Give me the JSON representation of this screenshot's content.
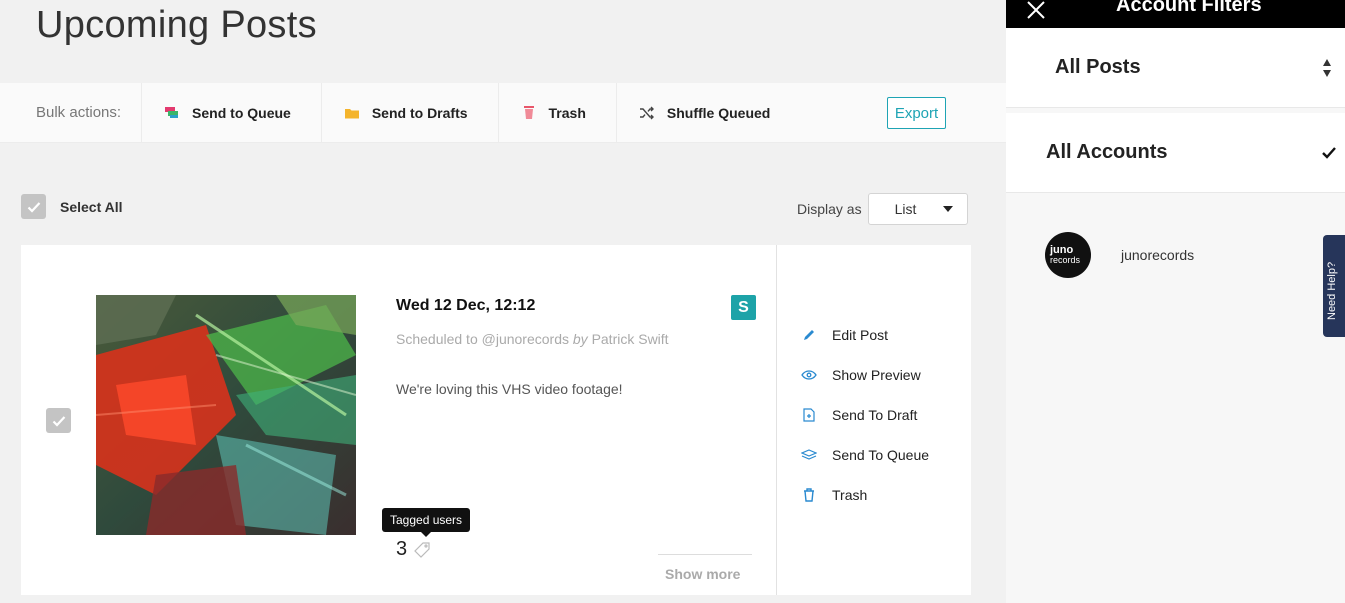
{
  "page": {
    "title": "Upcoming Posts"
  },
  "bulk": {
    "label": "Bulk actions:",
    "send_queue": "Send to Queue",
    "send_drafts": "Send to Drafts",
    "trash": "Trash",
    "shuffle": "Shuffle Queued",
    "export": "Export"
  },
  "toolbar": {
    "select_all": "Select All",
    "display_as": "Display as",
    "display_value": "List"
  },
  "post": {
    "date": "Wed 12 Dec, 12:12",
    "meta_prefix": "Scheduled to @junorecords",
    "meta_by": "by",
    "meta_author": "Patrick Swift",
    "caption": "We're loving this VHS video footage!",
    "badge": "S",
    "tooltip": "Tagged users",
    "tag_count": "3",
    "show_more": "Show more",
    "actions": {
      "edit": "Edit Post",
      "preview": "Show Preview",
      "draft": "Send To Draft",
      "queue": "Send To Queue",
      "trash": "Trash"
    }
  },
  "sidebar": {
    "title": "Account Filters",
    "filter": "All Posts",
    "accounts": "All Accounts",
    "account_name": "junorecords",
    "avatar_text_1": "juno",
    "avatar_text_2": "records",
    "help": "Need Help?"
  },
  "colors": {
    "accent": "#1ea4b4",
    "badge": "#1da3a8",
    "help": "#26355a"
  }
}
